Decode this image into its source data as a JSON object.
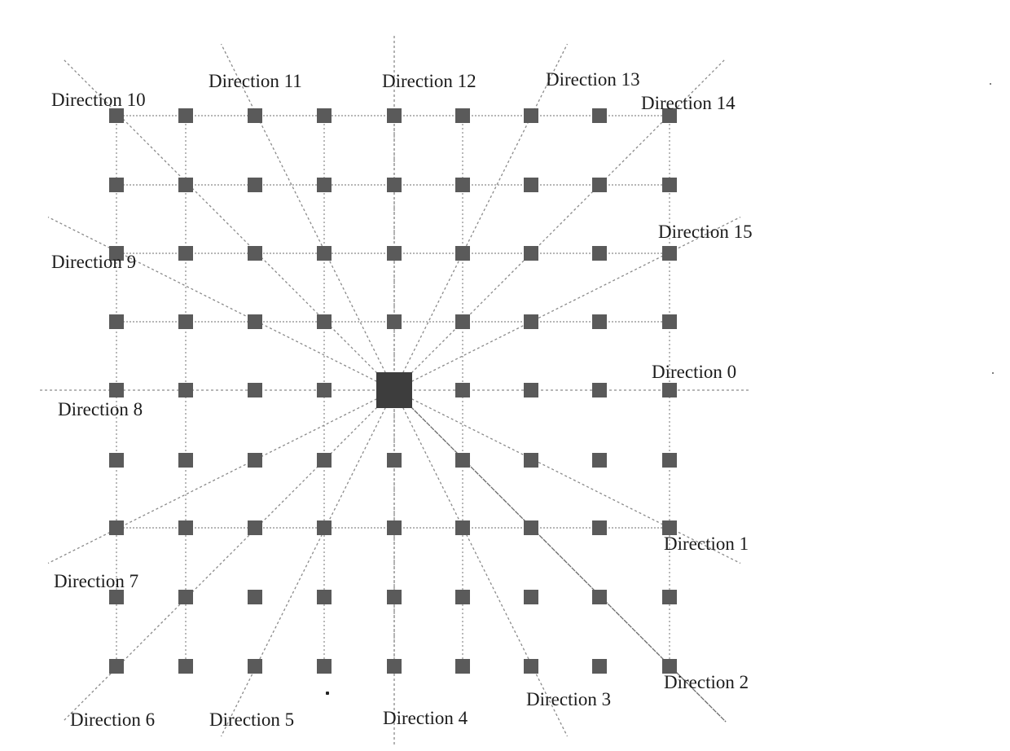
{
  "diagram": {
    "description": "16-direction ray pattern on a 9x9 grid of pixel squares around a central pixel",
    "grid_size": [
      9,
      9
    ],
    "center_cell": [
      4,
      4
    ],
    "node_color": "#5a5a5a",
    "center_color": "#3d3d3d",
    "line_color": "#8a8a8a",
    "grid_lines": {
      "horizontal_rows": [
        0,
        1,
        2,
        3,
        6
      ],
      "vertical_cols": [
        0,
        1,
        3,
        4,
        5,
        8
      ]
    },
    "directions": [
      {
        "id": 0,
        "label": "Direction 0",
        "step": [
          4,
          0
        ]
      },
      {
        "id": 1,
        "label": "Direction 1",
        "step": [
          4,
          2
        ]
      },
      {
        "id": 2,
        "label": "Direction 2",
        "step": [
          4,
          4
        ]
      },
      {
        "id": 3,
        "label": "Direction 3",
        "step": [
          2,
          4
        ]
      },
      {
        "id": 4,
        "label": "Direction 4",
        "step": [
          0,
          4
        ]
      },
      {
        "id": 5,
        "label": "Direction 5",
        "step": [
          -2,
          4
        ]
      },
      {
        "id": 6,
        "label": "Direction 6",
        "step": [
          -4,
          4
        ]
      },
      {
        "id": 7,
        "label": "Direction 7",
        "step": [
          -4,
          2
        ]
      },
      {
        "id": 8,
        "label": "Direction 8",
        "step": [
          -4,
          0
        ]
      },
      {
        "id": 9,
        "label": "Direction 9",
        "step": [
          -4,
          -2
        ]
      },
      {
        "id": 10,
        "label": "Direction 10",
        "step": [
          -4,
          -4
        ]
      },
      {
        "id": 11,
        "label": "Direction 11",
        "step": [
          -2,
          -4
        ]
      },
      {
        "id": 12,
        "label": "Direction 12",
        "step": [
          0,
          -4
        ]
      },
      {
        "id": 13,
        "label": "Direction 13",
        "step": [
          2,
          -4
        ]
      },
      {
        "id": 14,
        "label": "Direction 14",
        "step": [
          4,
          -4
        ]
      },
      {
        "id": 15,
        "label": "Direction 15",
        "step": [
          4,
          -2
        ]
      }
    ]
  }
}
